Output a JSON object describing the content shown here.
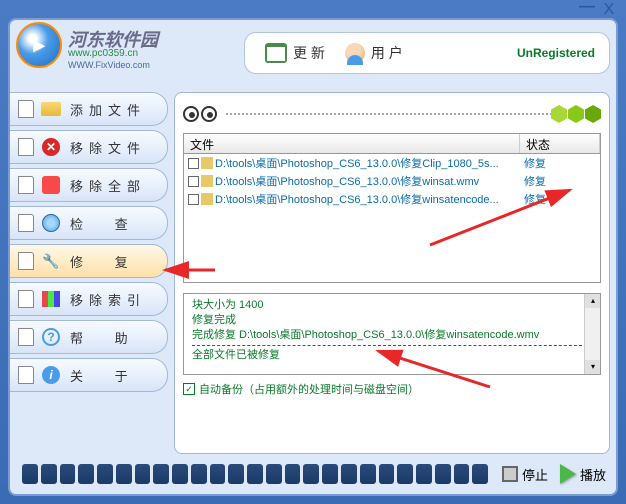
{
  "titlebar": {
    "close": "X",
    "min": "—"
  },
  "header": {
    "logo_text": "河东软件园",
    "logo_url": "www.pc0359.cn",
    "logo_sub": "WWW.FixVideo.com",
    "update_label": "更 新",
    "user_label": "用 户",
    "unregistered": "UnRegistered"
  },
  "sidebar": {
    "items": [
      {
        "label": "添加文件",
        "name": "add-file"
      },
      {
        "label": "移除文件",
        "name": "remove-file"
      },
      {
        "label": "移除全部",
        "name": "remove-all"
      },
      {
        "label": "检 查",
        "name": "check"
      },
      {
        "label": "修 复",
        "name": "repair"
      },
      {
        "label": "移除索引",
        "name": "remove-index"
      },
      {
        "label": "帮 助",
        "name": "help"
      },
      {
        "label": "关 于",
        "name": "about"
      }
    ]
  },
  "table": {
    "header_file": "文件",
    "header_status": "状态",
    "rows": [
      {
        "path": "D:\\tools\\桌面\\Photoshop_CS6_13.0.0\\修复Clip_1080_5s...",
        "status": "修复"
      },
      {
        "path": "D:\\tools\\桌面\\Photoshop_CS6_13.0.0\\修复winsat.wmv",
        "status": "修复"
      },
      {
        "path": "D:\\tools\\桌面\\Photoshop_CS6_13.0.0\\修复winsatencode...",
        "status": "修复"
      }
    ]
  },
  "log": {
    "line1": "块大小为 1400",
    "line2": "修复完成",
    "line3": "完成修复 D:\\tools\\桌面\\Photoshop_CS6_13.0.0\\修复winsatencode.wmv",
    "line4": "全部文件已被修复"
  },
  "auto_backup": {
    "label": "自动备份（占用额外的处理时间与磁盘空间）",
    "checked": "✓"
  },
  "footer": {
    "stop": "停止",
    "play": "播放"
  }
}
